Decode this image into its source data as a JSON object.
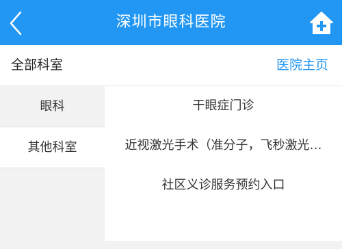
{
  "header": {
    "title": "深圳市眼科医院",
    "back_icon": "chevron-left-icon",
    "home_icon": "home-plus-icon",
    "color": "#2196f3"
  },
  "subheader": {
    "all_departments": "全部科室",
    "hospital_home": "医院主页"
  },
  "sidebar": {
    "items": [
      {
        "label": "眼科"
      },
      {
        "label": "其他科室"
      }
    ]
  },
  "content": {
    "items": [
      {
        "label": "干眼症门诊"
      },
      {
        "label": "近视激光手术（准分子，飞秒激光…"
      },
      {
        "label": "社区义诊服务预约入口"
      }
    ]
  }
}
